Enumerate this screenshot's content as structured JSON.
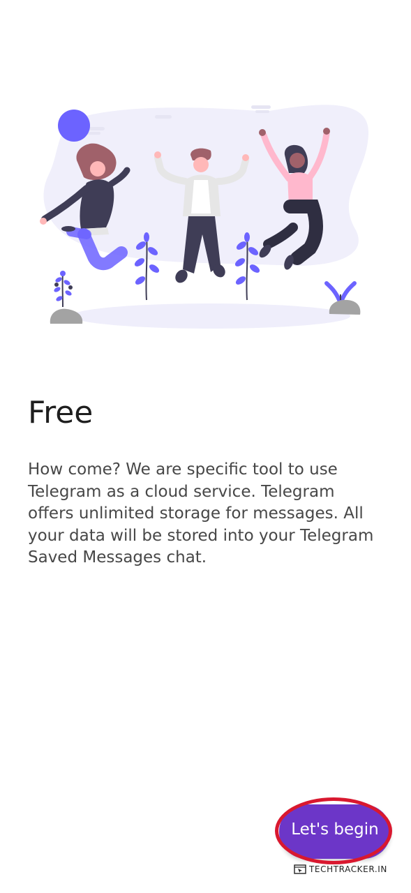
{
  "onboarding": {
    "title": "Free",
    "description": "How come? We are specific tool to use Telegram as a cloud service. Telegram offers unlimited storage for messages. All your data will be stored into your Telegram Saved Messages chat.",
    "begin_label": "Let's begin"
  },
  "watermark": {
    "text": "TECHTRACKER.IN"
  },
  "colors": {
    "accent": "#6c36c8",
    "highlight": "#d9182f",
    "illustration_blob": "#f0effb",
    "illustration_accent": "#6c63ff",
    "title_text": "#1e1e1e",
    "body_text": "#474747"
  },
  "icons": {
    "illustration": "people-jumping-illustration",
    "watermark_logo": "cursor-box-icon"
  }
}
